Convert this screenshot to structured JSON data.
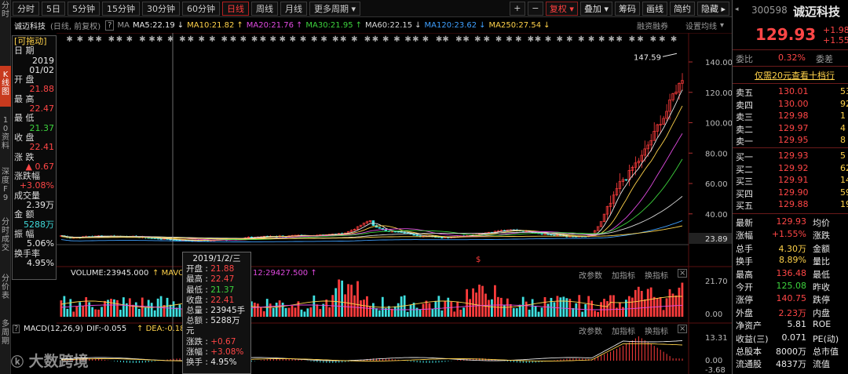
{
  "left_tabs": [
    "分时",
    "K线图",
    "10资料",
    "深度F9",
    "分时成交",
    "分价表",
    "多周期"
  ],
  "period_bar": {
    "periods": [
      "分时",
      "5日",
      "5分钟",
      "15分钟",
      "30分钟",
      "60分钟",
      "日线",
      "周线",
      "月线",
      "更多周期"
    ],
    "active": "日线",
    "buttons": [
      "复权",
      "叠加",
      "筹码",
      "画线",
      "简约",
      "隐藏"
    ]
  },
  "title": {
    "stock_name": "诚迈科技",
    "adj_mode": "(日线, 前复权)",
    "help": "?",
    "ma_label": "MA",
    "ma": [
      {
        "text": "MA5:22.19",
        "color": "#e8e8e8"
      },
      {
        "text": "MA10:21.82",
        "color": "#ffd24a"
      },
      {
        "text": "MA20:21.76",
        "color": "#e04ae0"
      },
      {
        "text": "MA30:21.95",
        "color": "#3dd23d"
      },
      {
        "text": "MA60:22.15",
        "color": "#d8d8d8"
      },
      {
        "text": "MA120:23.62",
        "color": "#3fa0ff"
      },
      {
        "text": "MA250:27.54",
        "color": "#ffd24a"
      }
    ],
    "financing": "融资融券",
    "ma_settings": "设置均线"
  },
  "info_panel": {
    "tag": "[可拖动]",
    "date_label": "日 期",
    "date_year": "2019",
    "date_md": "01/02",
    "open_label": "开 盘",
    "open": "21.88",
    "high_label": "最 高",
    "high": "22.47",
    "low_label": "最 低",
    "low": "21.37",
    "close_label": "收 盘",
    "close": "22.41",
    "change_label": "涨 跌",
    "change": "▲ 0.67",
    "pct_label": "涨跌幅",
    "pct": "+3.08%",
    "vol_label": "成交量",
    "vol": "2.39万",
    "amt_label": "金 额",
    "amt": "5288万",
    "amp_label": "振 幅",
    "amp": "5.06%",
    "turn_label": "换手率",
    "turn": "4.95%"
  },
  "main_chart": {
    "max_label": "147.59",
    "y_ticks": [
      "140.00",
      "120.00",
      "100.00",
      "80.00",
      "60.00",
      "40.00",
      "23.89"
    ],
    "marker": "$"
  },
  "volume_panel": {
    "volume": "VOLUME:23945.000",
    "mavol1": "MAVOL1",
    "mavol2": "12:29427.500",
    "y_ticks": [
      "21.70",
      "0.00"
    ],
    "btn_params": "改参数",
    "btn_add": "加指标",
    "btn_switch": "换指标"
  },
  "macd_panel": {
    "label": "MACD(12,26,9)",
    "dif": "DIF:-0.055",
    "dea": "DEA:-0.18",
    "y_ticks": [
      "13.31",
      "0.00",
      "-3.68"
    ],
    "btn_params": "改参数",
    "btn_add": "加指标",
    "btn_switch": "换指标"
  },
  "tooltip": {
    "date": "2019/1/2/三",
    "open": "21.88",
    "high": "22.47",
    "low": "21.37",
    "close": "22.41",
    "vol": "23945手",
    "amt": "5288万元",
    "chg": "+0.67",
    "pct": "+3.08%",
    "turn": "4.95%"
  },
  "watermark": "大数跨境",
  "right_panel": {
    "code": "300598",
    "name": "诚迈科技",
    "price": "129.93",
    "change": "+1.98",
    "change_pct": "+1.55",
    "weibi_label": "委比",
    "weibi": "0.32%",
    "weicha_label": "委差",
    "promo": "仅需20元查看十档行",
    "asks": [
      {
        "label": "卖五",
        "price": "130.01",
        "vol": "53"
      },
      {
        "label": "卖四",
        "price": "130.00",
        "vol": "92"
      },
      {
        "label": "卖三",
        "price": "129.98",
        "vol": "1"
      },
      {
        "label": "卖二",
        "price": "129.97",
        "vol": "4"
      },
      {
        "label": "卖一",
        "price": "129.95",
        "vol": "8"
      }
    ],
    "bids": [
      {
        "label": "买一",
        "price": "129.93",
        "vol": "5"
      },
      {
        "label": "买二",
        "price": "129.92",
        "vol": "62"
      },
      {
        "label": "买三",
        "price": "129.91",
        "vol": "14"
      },
      {
        "label": "买四",
        "price": "129.90",
        "vol": "59"
      },
      {
        "label": "买五",
        "price": "129.88",
        "vol": "19"
      }
    ],
    "stats": [
      {
        "l1": "最新",
        "v1": "129.93",
        "c1": "red",
        "l2": "均价"
      },
      {
        "l1": "涨幅",
        "v1": "+1.55%",
        "c1": "red",
        "l2": "涨跌"
      },
      {
        "l1": "总手",
        "v1": "4.30万",
        "c1": "yellow",
        "l2": "金额"
      },
      {
        "l1": "换手",
        "v1": "8.89%",
        "c1": "yellow",
        "l2": "量比"
      },
      {
        "l1": "最高",
        "v1": "136.48",
        "c1": "red",
        "l2": "最低"
      },
      {
        "l1": "今开",
        "v1": "125.08",
        "c1": "green",
        "l2": "昨收"
      },
      {
        "l1": "涨停",
        "v1": "140.75",
        "c1": "red",
        "l2": "跌停"
      },
      {
        "l1": "外盘",
        "v1": "2.23万",
        "c1": "red",
        "l2": "内盘"
      },
      {
        "l1": "净资产",
        "v1": "5.81",
        "c1": "white",
        "l2": "ROE"
      },
      {
        "l1": "收益(三)",
        "v1": "0.071",
        "c1": "white",
        "l2": "PE(动)"
      },
      {
        "l1": "总股本",
        "v1": "8000万",
        "c1": "white",
        "l2": "总市值"
      },
      {
        "l1": "流通股",
        "v1": "4837万",
        "c1": "white",
        "l2": "流值"
      }
    ]
  }
}
